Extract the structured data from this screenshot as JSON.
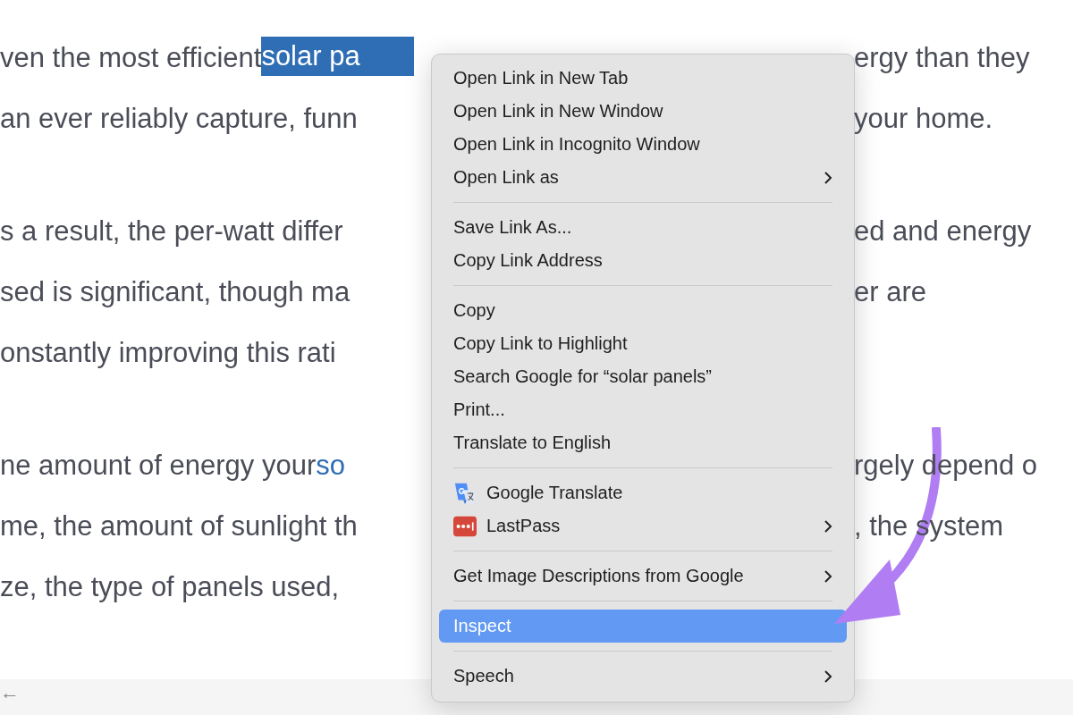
{
  "article": {
    "paragraphs": [
      {
        "lines": [
          {
            "left": [
              {
                "kind": "text",
                "text": "ven the most efficient "
              },
              {
                "kind": "selection",
                "text": "solar pa"
              }
            ],
            "right": "ergy than they"
          },
          {
            "left": [
              {
                "kind": "text",
                "text": "an ever reliably capture, funn"
              }
            ],
            "right": "your home."
          }
        ]
      },
      {
        "lines": [
          {
            "left": [
              {
                "kind": "text",
                "text": "s a result, the per-watt differ"
              }
            ],
            "right": "ed and energy"
          },
          {
            "left": [
              {
                "kind": "text",
                "text": "sed is significant, though ma"
              }
            ],
            "right": "er are"
          },
          {
            "left": [
              {
                "kind": "text",
                "text": "onstantly improving this rati"
              }
            ]
          }
        ]
      },
      {
        "lines": [
          {
            "left": [
              {
                "kind": "text",
                "text": "ne amount of energy your "
              },
              {
                "kind": "link",
                "text": "so"
              }
            ],
            "right": "rgely depend o"
          },
          {
            "left": [
              {
                "kind": "text",
                "text": "me, the amount of sunlight th"
              }
            ],
            "right": ", the system"
          },
          {
            "left": [
              {
                "kind": "text",
                "text": "ze, the type of panels used,"
              }
            ]
          }
        ]
      }
    ]
  },
  "footer": {
    "back": "←"
  },
  "context_menu": {
    "groups": [
      {
        "items": [
          {
            "label": "Open Link in New Tab",
            "kind": "text",
            "submenu": false,
            "selected": false
          },
          {
            "label": "Open Link in New Window",
            "kind": "text",
            "submenu": false,
            "selected": false
          },
          {
            "label": "Open Link in Incognito Window",
            "kind": "text",
            "submenu": false,
            "selected": false
          },
          {
            "label": "Open Link as",
            "kind": "text",
            "submenu": true,
            "selected": false
          }
        ]
      },
      {
        "items": [
          {
            "label": "Save Link As...",
            "kind": "text",
            "submenu": false,
            "selected": false
          },
          {
            "label": "Copy Link Address",
            "kind": "text",
            "submenu": false,
            "selected": false
          }
        ]
      },
      {
        "items": [
          {
            "label": "Copy",
            "kind": "text",
            "submenu": false,
            "selected": false
          },
          {
            "label": "Copy Link to Highlight",
            "kind": "text",
            "submenu": false,
            "selected": false
          },
          {
            "label": "Search Google for “solar panels”",
            "kind": "text",
            "submenu": false,
            "selected": false
          },
          {
            "label": "Print...",
            "kind": "text",
            "submenu": false,
            "selected": false
          },
          {
            "label": "Translate to English",
            "kind": "text",
            "submenu": false,
            "selected": false
          }
        ]
      },
      {
        "items": [
          {
            "label": "Google Translate",
            "kind": "translate",
            "submenu": false,
            "selected": false
          },
          {
            "label": "LastPass",
            "kind": "password",
            "submenu": true,
            "selected": false
          }
        ]
      },
      {
        "items": [
          {
            "label": "Get Image Descriptions from Google",
            "kind": "text",
            "submenu": true,
            "selected": false
          }
        ]
      },
      {
        "items": [
          {
            "label": "Inspect",
            "kind": "text",
            "submenu": false,
            "selected": true
          }
        ]
      },
      {
        "items": [
          {
            "label": "Speech",
            "kind": "text",
            "submenu": true,
            "selected": false
          }
        ]
      }
    ]
  }
}
